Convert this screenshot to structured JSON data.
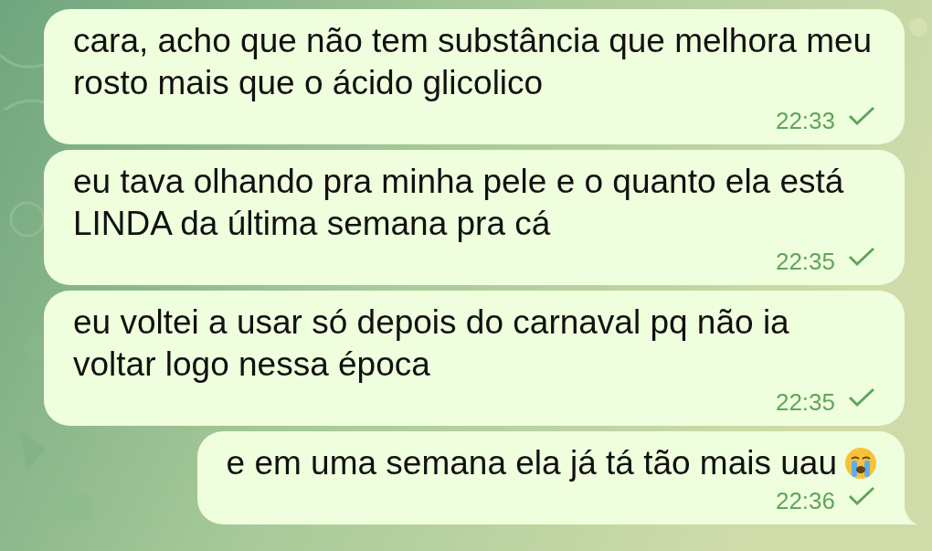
{
  "messages": [
    {
      "text": "cara, acho que não tem substância que melhora meu rosto mais que o ácido glicolico",
      "time": "22:33",
      "read": false,
      "emoji": false,
      "tail": false
    },
    {
      "text": "eu tava olhando pra minha pele e o quanto ela está LINDA da última semana pra cá",
      "time": "22:35",
      "read": false,
      "emoji": false,
      "tail": false
    },
    {
      "text": "eu voltei a usar só depois do carnaval pq não ia voltar logo nessa época",
      "time": "22:35",
      "read": false,
      "emoji": false,
      "tail": false
    },
    {
      "text": "e em uma semana ela já tá tão mais uau",
      "time": "22:36",
      "read": false,
      "emoji": true,
      "tail": true
    }
  ]
}
